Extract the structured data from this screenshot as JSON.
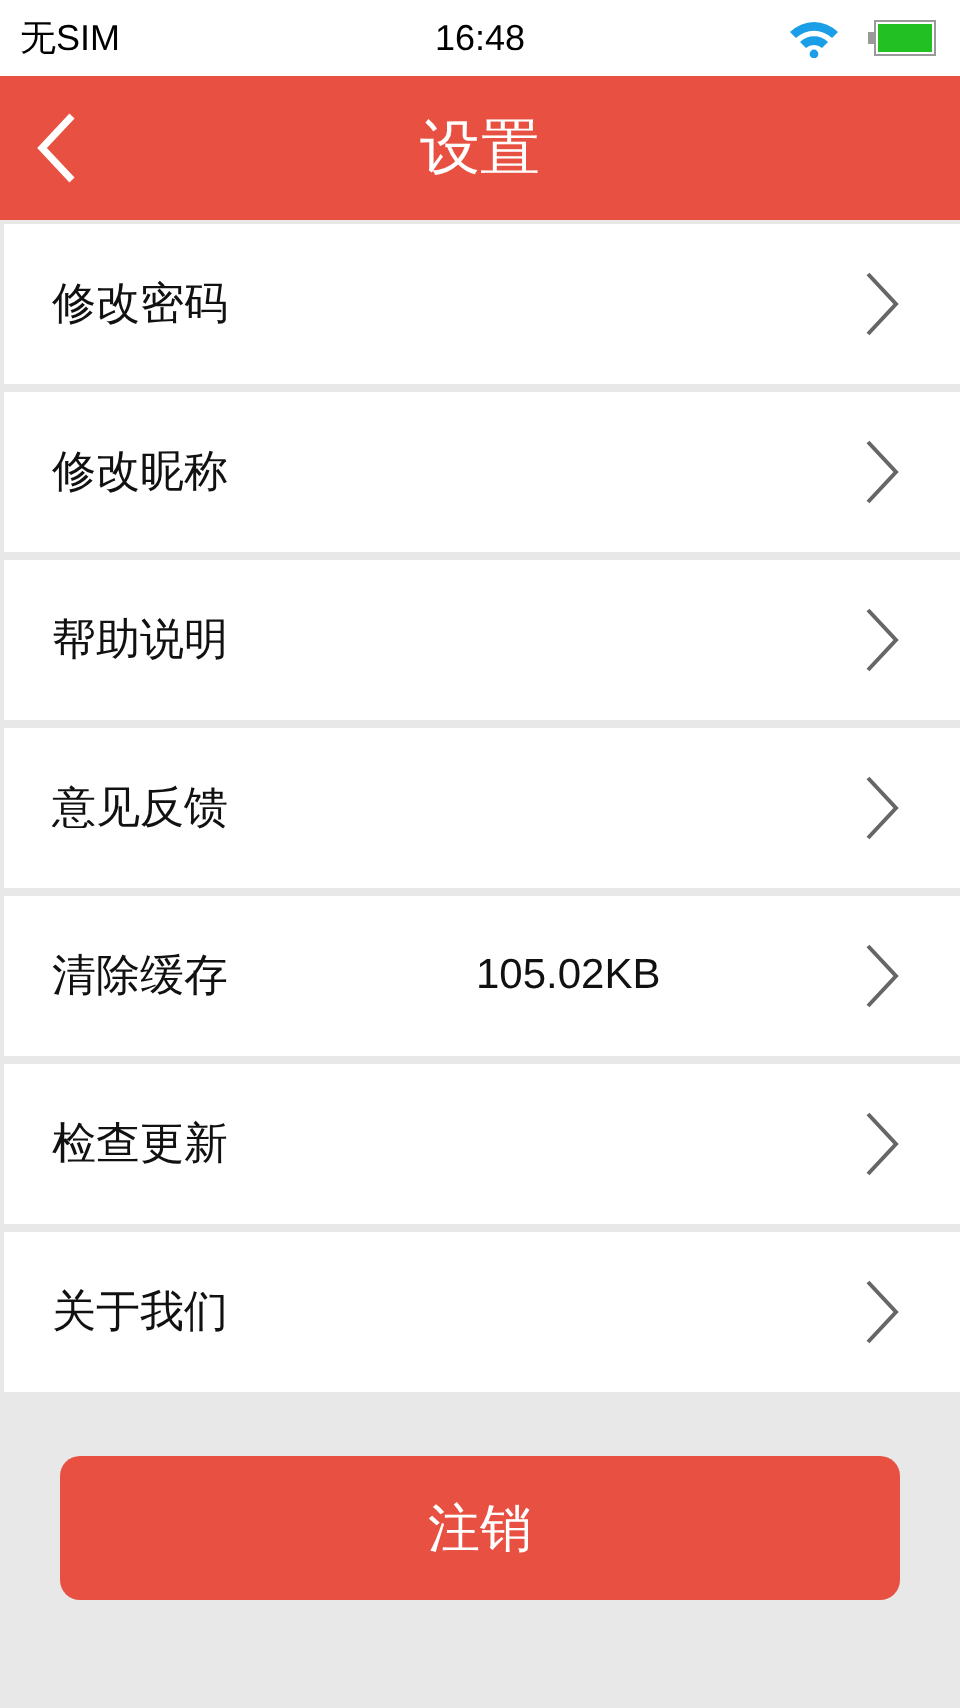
{
  "status_bar": {
    "carrier": "无SIM",
    "time": "16:48"
  },
  "header": {
    "title": "设置"
  },
  "items": [
    {
      "label": "修改密码"
    },
    {
      "label": "修改昵称"
    },
    {
      "label": "帮助说明"
    },
    {
      "label": "意见反馈"
    },
    {
      "label": "清除缓存",
      "value": "105.02KB"
    },
    {
      "label": "检查更新"
    },
    {
      "label": "关于我们"
    }
  ],
  "logout_button": "注销"
}
